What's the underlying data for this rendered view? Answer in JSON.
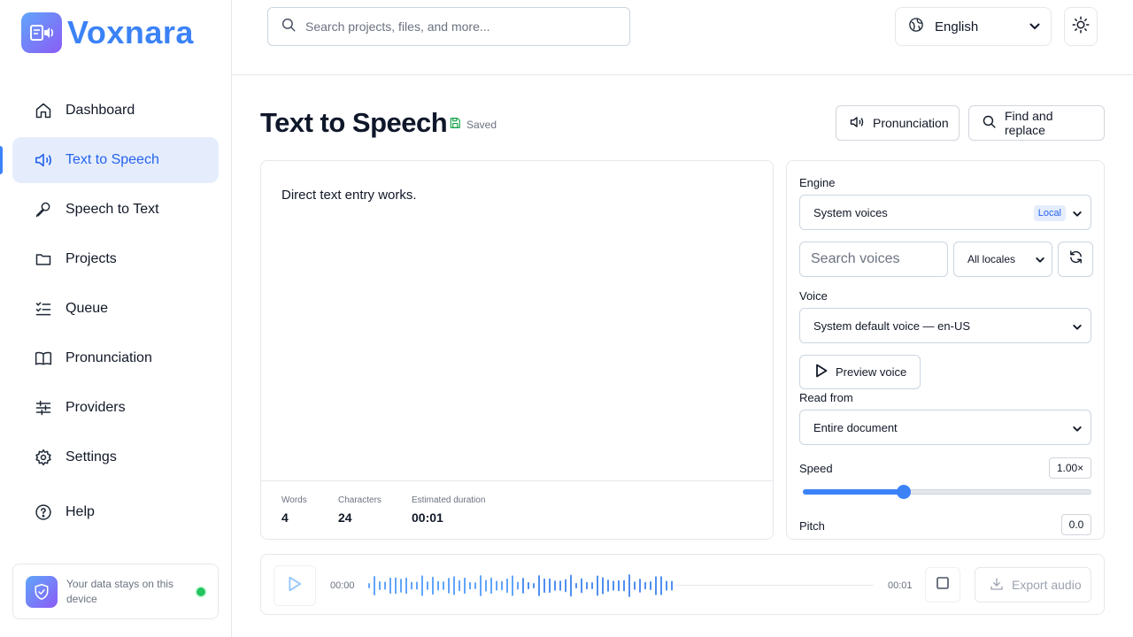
{
  "app": {
    "name": "Voxnara"
  },
  "sidebar": {
    "items": [
      {
        "label": "Dashboard",
        "icon": "home-icon"
      },
      {
        "label": "Text to Speech",
        "icon": "speaker-icon",
        "active": true
      },
      {
        "label": "Speech to Text",
        "icon": "microphone-icon"
      },
      {
        "label": "Projects",
        "icon": "folder-icon"
      },
      {
        "label": "Queue",
        "icon": "list-checks-icon"
      },
      {
        "label": "Pronunciation",
        "icon": "book-icon"
      },
      {
        "label": "Providers",
        "icon": "sliders-icon"
      },
      {
        "label": "Settings",
        "icon": "gear-icon"
      },
      {
        "label": "Help",
        "icon": "help-circle-icon"
      }
    ],
    "privacy_text": "Your data stays on this device"
  },
  "topbar": {
    "search_placeholder": "Search projects, files, and more...",
    "language": "English"
  },
  "page": {
    "title": "Text to Speech",
    "saved_label": "Saved",
    "pronunciation_button": "Pronunciation",
    "find_replace_button": "Find and replace"
  },
  "editor": {
    "text": "Direct text entry works.",
    "stats": {
      "words_label": "Words",
      "words": "4",
      "characters_label": "Characters",
      "characters": "24",
      "duration_label": "Estimated duration",
      "duration": "00:01"
    }
  },
  "settings": {
    "engine_label": "Engine",
    "engine_value": "System voices",
    "engine_badge": "Local",
    "voice_search_placeholder": "Search voices",
    "locale_value": "All locales",
    "voice_label": "Voice",
    "voice_value": "System default voice — en-US",
    "preview_button": "Preview voice",
    "read_from_label": "Read from",
    "read_from_value": "Entire document",
    "speed_label": "Speed",
    "speed_value": "1.00×",
    "speed_fraction": 0.35,
    "pitch_label": "Pitch",
    "pitch_value": "0.0"
  },
  "player": {
    "current_time": "00:00",
    "total_time": "00:01",
    "export_button": "Export audio"
  },
  "colors": {
    "accent": "#3b82f6",
    "active_bg": "#e5edfd",
    "status_green": "#22c55e"
  }
}
